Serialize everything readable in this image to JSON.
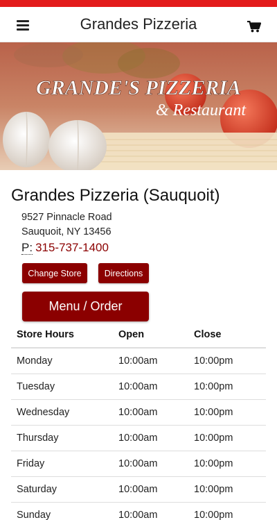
{
  "colors": {
    "accent": "#e31b1b",
    "button": "#8b0000",
    "phone": "#8b0000"
  },
  "header": {
    "menu_icon": "hamburger-menu-icon",
    "title": "Grandes Pizzeria",
    "cart_icon": "shopping-cart-icon"
  },
  "banner": {
    "logo_line1": "GRANDE'S PIZZERIA",
    "logo_line2": "& Restaurant"
  },
  "store": {
    "name": "Grandes Pizzeria (Sauquoit)",
    "address_line1": "9527 Pinnacle Road",
    "address_line2": "Sauquoit, NY 13456",
    "phone_label": "P:",
    "phone": "315-737-1400"
  },
  "buttons": {
    "change_store": "Change Store",
    "directions": "Directions",
    "menu_order": "Menu / Order"
  },
  "hours": {
    "columns": [
      "Store Hours",
      "Open",
      "Close"
    ],
    "rows": [
      [
        "Monday",
        "10:00am",
        "10:00pm"
      ],
      [
        "Tuesday",
        "10:00am",
        "10:00pm"
      ],
      [
        "Wednesday",
        "10:00am",
        "10:00pm"
      ],
      [
        "Thursday",
        "10:00am",
        "10:00pm"
      ],
      [
        "Friday",
        "10:00am",
        "10:00pm"
      ],
      [
        "Saturday",
        "10:00am",
        "10:00pm"
      ],
      [
        "Sunday",
        "10:00am",
        "10:00pm"
      ]
    ]
  }
}
